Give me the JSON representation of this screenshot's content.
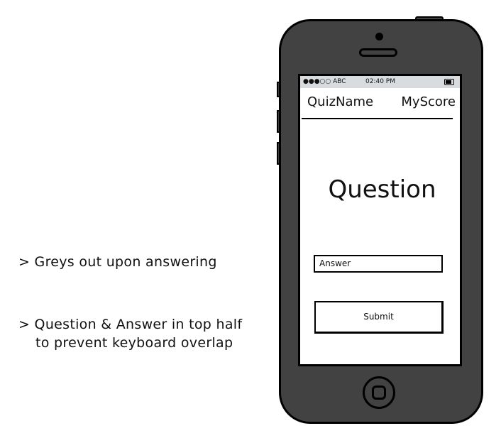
{
  "annotations": [
    "> Greys out upon answering",
    "> Question & Answer in top half",
    "to prevent keyboard overlap"
  ],
  "phone": {
    "status_bar": {
      "signal": "●●●○○ ABC",
      "time": "02:40 PM",
      "battery_icon": "battery-icon"
    },
    "header": {
      "quiz_name": "QuizName",
      "score": "MyScore"
    },
    "question": "Question",
    "answer_field": {
      "value": "Answer"
    },
    "submit_label": "Submit"
  }
}
